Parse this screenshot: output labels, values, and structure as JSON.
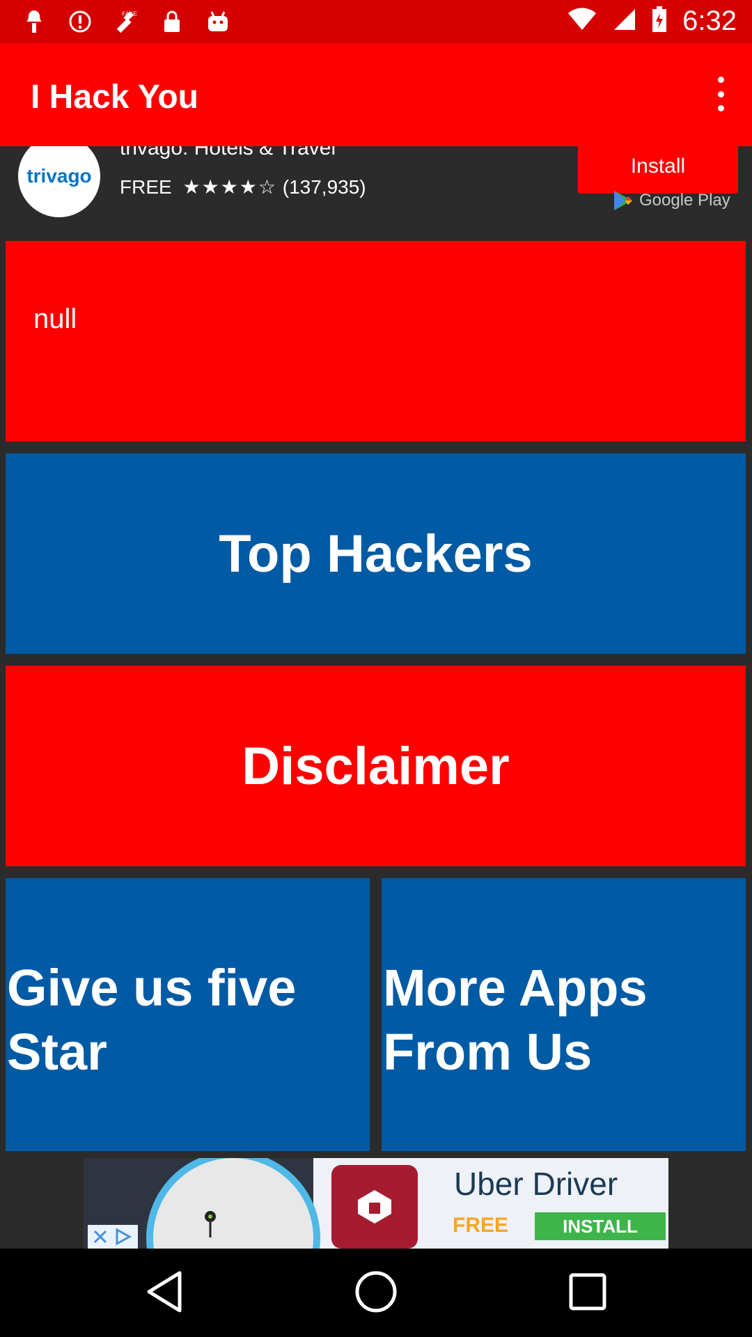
{
  "status_bar": {
    "time": "6:32",
    "icons": [
      "notification-icon",
      "alert-icon",
      "fake-gps-icon",
      "lock-icon",
      "android-icon"
    ],
    "right_icons": [
      "wifi-icon",
      "signal-icon",
      "battery-icon"
    ]
  },
  "app_bar": {
    "title": "I Hack You",
    "menu_icon": "more-vert-icon"
  },
  "top_ad": {
    "logo_text": "trivago",
    "app_name": "trivago: Hotels & Travel",
    "price": "FREE",
    "stars": "★★★★☆",
    "rating_count": "(137,935)",
    "install_label": "Install",
    "store_label": "Google Play"
  },
  "tiles": {
    "null_label": "null",
    "top_hackers": "Top Hackers",
    "disclaimer": "Disclaimer",
    "five_star": "Give us five Star",
    "more_apps": "More Apps From Us"
  },
  "bottom_ad": {
    "title": "Uber Driver",
    "price": "FREE",
    "install_label": "INSTALL"
  },
  "colors": {
    "status_bar": "#d50000",
    "app_bar": "#ff0000",
    "tile_red": "#ff0000",
    "tile_blue": "#005aa4",
    "background": "#2b2b2b"
  },
  "nav": {
    "back": "back-icon",
    "home": "home-icon",
    "recents": "recents-icon"
  }
}
